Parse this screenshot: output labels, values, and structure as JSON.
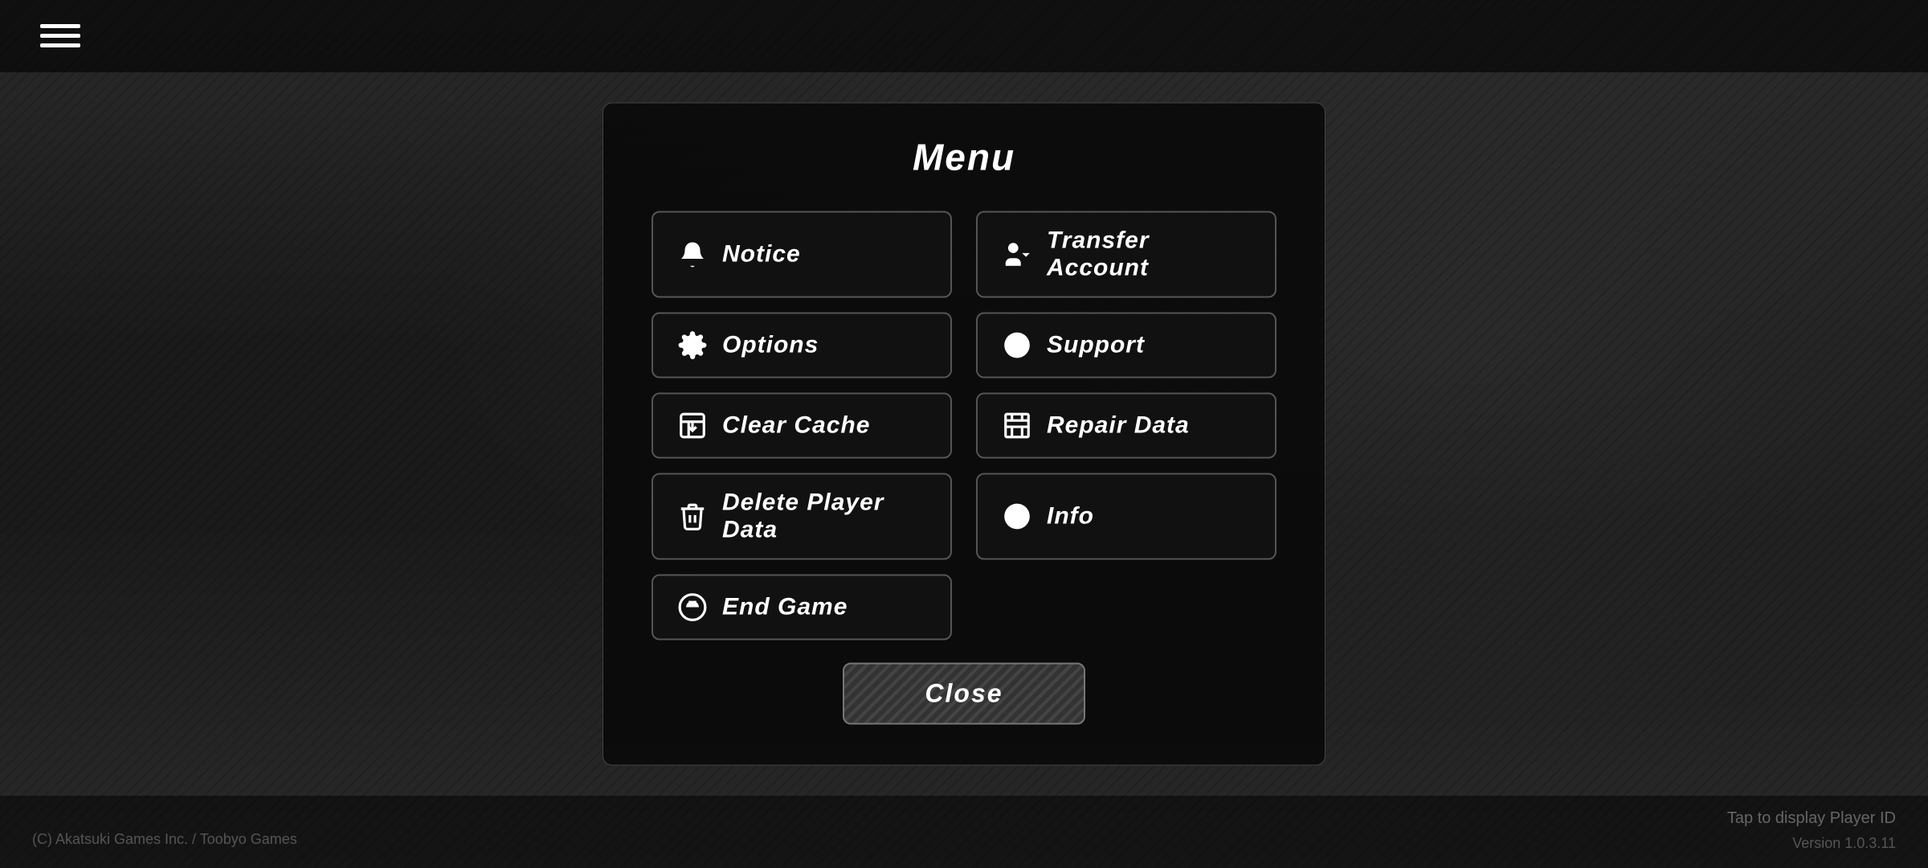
{
  "header": {
    "title": "Menu"
  },
  "hamburger": {
    "label": "hamburger menu"
  },
  "buttons": {
    "notice": "Notice",
    "transfer_account": "Transfer Account",
    "options": "Options",
    "support": "Support",
    "clear_cache": "Clear Cache",
    "repair_data": "Repair Data",
    "delete_player_data": "Delete Player Data",
    "info": "Info",
    "end_game": "End Game",
    "close": "Close"
  },
  "footer": {
    "copyright": "(C) Akatsuki Games Inc. / Toobyo Games",
    "tap_player_id": "Tap to display Player ID",
    "version": "Version 1.0.3.11"
  }
}
